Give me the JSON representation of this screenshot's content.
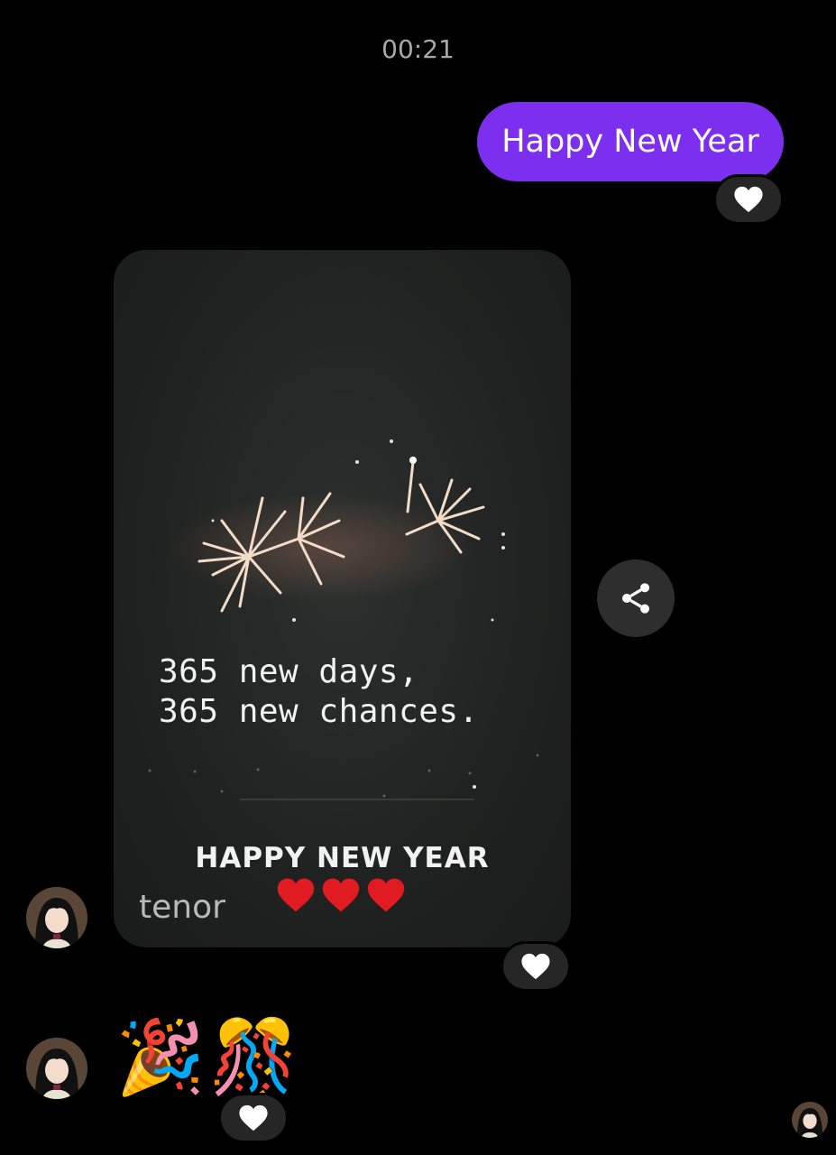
{
  "chat": {
    "timestamp": "00:21",
    "sent_message": {
      "text": "Happy New Year",
      "reaction": "white-heart"
    },
    "gif_message": {
      "quote_line_1": "365 new days,",
      "quote_line_2": "365 new chances.",
      "greeting": "HAPPY NEW YEAR",
      "hearts": 3,
      "watermark": "tenor",
      "reaction": "white-heart"
    },
    "emoji_message": {
      "emojis": [
        "🎉",
        "🎊"
      ],
      "reaction": "white-heart"
    }
  },
  "colors": {
    "background": "#000000",
    "sent_bubble": "#7d2ff0",
    "reaction_pill": "#262626",
    "share_button": "#2e2e2e",
    "timestamp": "#a8a8a8"
  },
  "icons": {
    "reaction": "white-heart-icon",
    "share": "share-icon",
    "avatar": "anime-avatar"
  }
}
